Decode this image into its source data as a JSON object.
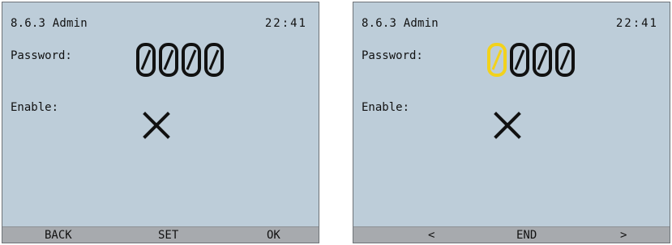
{
  "screens": [
    {
      "title": "8.6.3 Admin",
      "clock": "22:41",
      "password_label": "Password:",
      "password_digits": [
        "0",
        "0",
        "0",
        "0"
      ],
      "active_digit_index": null,
      "enable_label": "Enable:",
      "enable_state": "disabled (cross-icon)",
      "softkeys": [
        "BACK",
        "SET",
        "OK"
      ]
    },
    {
      "title": "8.6.3 Admin",
      "clock": "22:41",
      "password_label": "Password:",
      "password_digits": [
        "0",
        "0",
        "0",
        "0"
      ],
      "active_digit_index": 0,
      "enable_label": "Enable:",
      "enable_state": "disabled (cross-icon)",
      "softkeys": [
        "<",
        "END",
        ">"
      ]
    }
  ],
  "colors": {
    "screen_bg": "#bdcdd9",
    "softkey_bar": "#a7aaae",
    "digit": "#111111",
    "digit_active": "#f2d21c"
  }
}
